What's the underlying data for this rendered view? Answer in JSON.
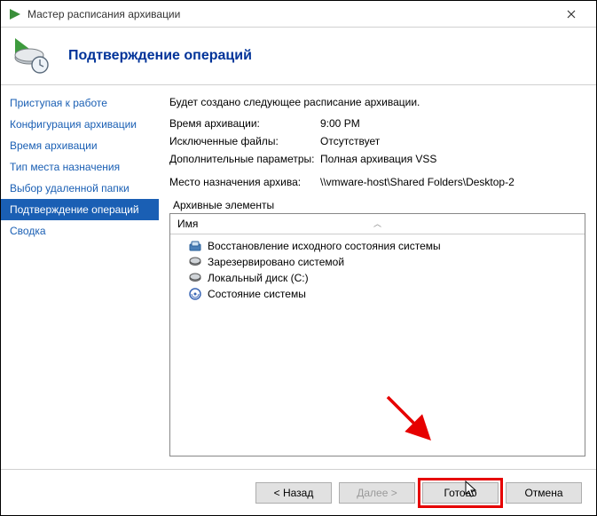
{
  "window": {
    "title": "Мастер расписания архивации"
  },
  "header": {
    "title": "Подтверждение операций"
  },
  "sidebar": {
    "items": [
      {
        "label": "Приступая к работе"
      },
      {
        "label": "Конфигурация архивации"
      },
      {
        "label": "Время архивации"
      },
      {
        "label": "Тип места назначения"
      },
      {
        "label": "Выбор удаленной папки"
      },
      {
        "label": "Подтверждение операций",
        "selected": true
      },
      {
        "label": "Сводка"
      }
    ]
  },
  "content": {
    "description": "Будет создано следующее расписание архивации.",
    "rows": [
      {
        "label": "Время архивации:",
        "value": "9:00 PM"
      },
      {
        "label": "Исключенные файлы:",
        "value": "Отсутствует"
      },
      {
        "label": "Дополнительные параметры:",
        "value": "Полная архивация VSS"
      },
      {
        "label": "Место назначения архива:",
        "value": "\\\\vmware-host\\Shared Folders\\Desktop-2"
      }
    ],
    "section_label": "Архивные элементы",
    "list": {
      "column": "Имя",
      "items": [
        {
          "icon": "recovery-icon",
          "label": "Восстановление исходного состояния системы"
        },
        {
          "icon": "reserved-icon",
          "label": "Зарезервировано системой"
        },
        {
          "icon": "disk-icon",
          "label": "Локальный диск (C:)"
        },
        {
          "icon": "system-state-icon",
          "label": "Состояние системы"
        }
      ]
    }
  },
  "footer": {
    "back": "< Назад",
    "next": "Далее >",
    "finish": "Готово",
    "cancel": "Отмена"
  }
}
